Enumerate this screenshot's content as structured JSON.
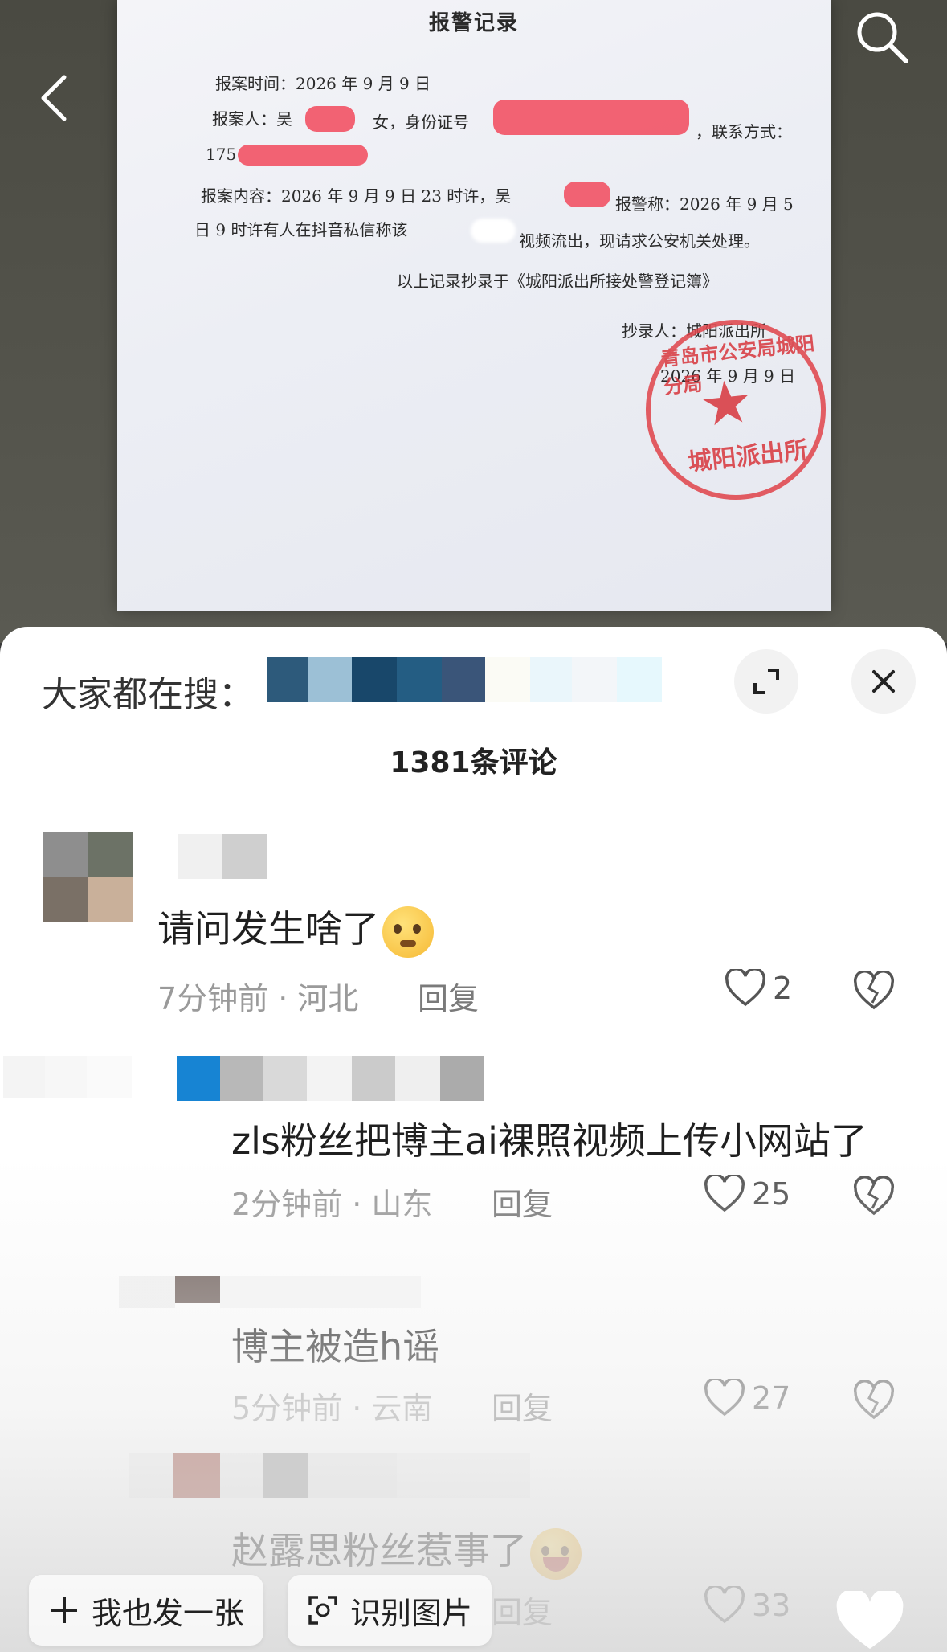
{
  "document": {
    "title": "报警记录",
    "line1": "报案时间：2026 年 9 月 9 日",
    "line2_a": "报案人：吴",
    "line2_b": "女，身份证号",
    "line2_c": "，联系方式：",
    "line3": "175",
    "line4_a": "报案内容：2026 年 9 月 9 日 23 时许，吴",
    "line4_b": "报警称：2026 年 9 月 5",
    "line5_a": "日 9 时许有人在抖音私信称该",
    "line5_b": "视频流出，现请求公安机关处理。",
    "line6": "以上记录抄录于《城阳派出所接处警登记簿》",
    "line7": "抄录人：城阳派出所",
    "line8": "2026 年 9 月 9 日",
    "seal_arc": "青岛市公安局城阳分局",
    "seal_bottom": "城阳派出所"
  },
  "sheet": {
    "trending_label": "大家都在搜：",
    "comment_count": "1381条评论"
  },
  "comments": [
    {
      "text": "请问发生啥了",
      "time": "7分钟前 · 河北",
      "reply": "回复",
      "likes": "2"
    },
    {
      "text": "zls粉丝把博主ai裸照视频上传小网站了",
      "time": "2分钟前 · 山东",
      "reply": "回复",
      "likes": "25"
    },
    {
      "text": "博主被造h谣",
      "time": "5分钟前 · 云南",
      "reply": "回复",
      "likes": "27"
    },
    {
      "text": "赵露思粉丝惹事了",
      "time": "",
      "reply": "回复",
      "likes": "33"
    }
  ],
  "bottom": {
    "post_label": "我也发一张",
    "identify_label": "识别图片"
  },
  "colors": {
    "accent_red": "#f15a6b",
    "seal_red": "#e0434a",
    "text_gray": "#9a9a9a"
  },
  "icons": [
    "back-icon",
    "search-icon",
    "expand-icon",
    "close-icon",
    "heart-icon",
    "broken-heart-icon",
    "plus-icon",
    "scan-icon"
  ]
}
